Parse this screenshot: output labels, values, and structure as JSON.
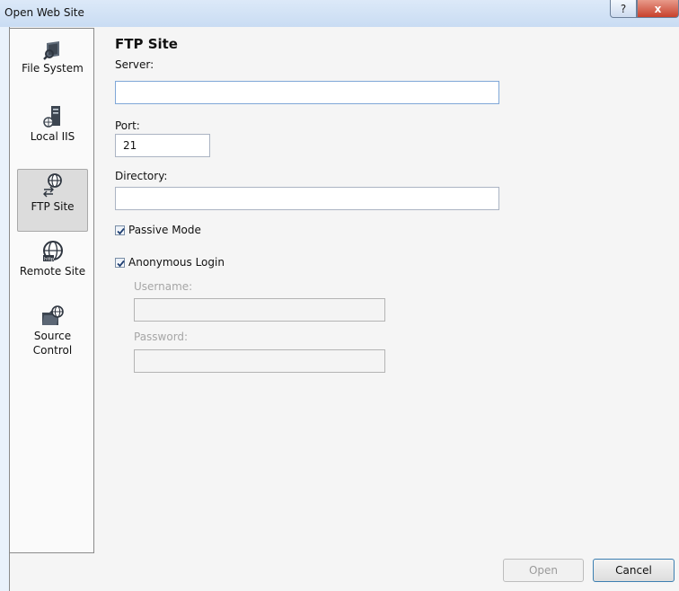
{
  "window": {
    "title": "Open Web Site"
  },
  "titlebar": {
    "help": "?",
    "close": "x"
  },
  "sidebar": {
    "items": [
      {
        "label": "File System",
        "icon": "folder-search-icon",
        "selected": false
      },
      {
        "label": "Local IIS",
        "icon": "server-globe-icon",
        "selected": false
      },
      {
        "label": "FTP Site",
        "icon": "ftp-globe-icon",
        "selected": true
      },
      {
        "label": "Remote Site",
        "icon": "http-globe-icon",
        "selected": false
      },
      {
        "label": "Source Control",
        "icon": "folder-globe-icon",
        "selected": false
      }
    ]
  },
  "form": {
    "heading": "FTP Site",
    "server_label": "Server:",
    "server_value": "",
    "port_label": "Port:",
    "port_value": "21",
    "directory_label": "Directory:",
    "directory_value": "",
    "passive_label": "Passive Mode",
    "passive_checked": true,
    "anon_label": "Anonymous Login",
    "anon_checked": true,
    "username_label": "Username:",
    "username_value": "",
    "password_label": "Password:",
    "password_value": ""
  },
  "buttons": {
    "open": "Open",
    "cancel": "Cancel"
  }
}
